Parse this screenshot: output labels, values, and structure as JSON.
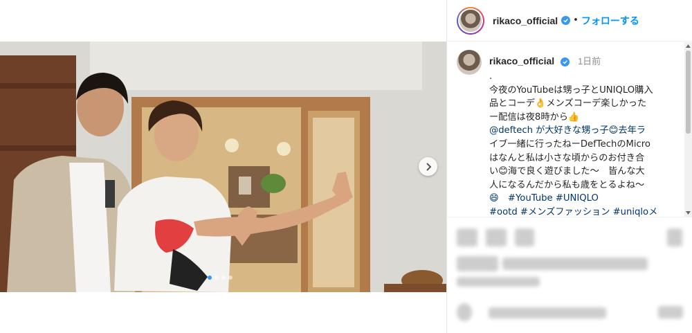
{
  "post": {
    "username": "rikaco_official",
    "follow_label": "フォローする",
    "separator": "•",
    "time_ago": "1日前",
    "caption_lines": [
      ".",
      "今夜のYouTubeは甥っ子とUNIQLO購入",
      "品とコーデ👌メンズコーデ楽しかった",
      "ー配信は夜8時から👍",
      "@deftech が大好きな甥っ子😊去年ラ",
      "イブ一緒に行ったねーDefTechのMicro",
      "はなんと私は小さな頃からのお付き合",
      "い😊海で良く遊びました〜　皆んな大",
      "人になるんだから私も歳をとるよね〜",
      "😄　#YouTube #UNIQLO",
      "#ootd #メンズファッション #uniqloメ"
    ]
  },
  "carousel": {
    "slide_count": 4,
    "active_index": 0
  },
  "icons": [
    "verified-badge-icon",
    "chevron-right-icon",
    "scroll-up-icon",
    "scroll-down-icon"
  ],
  "colors": {
    "accent": "#0095f6",
    "verified": "#3897f0",
    "text": "#262626",
    "muted": "#8e8e8e",
    "link": "#00376b"
  }
}
